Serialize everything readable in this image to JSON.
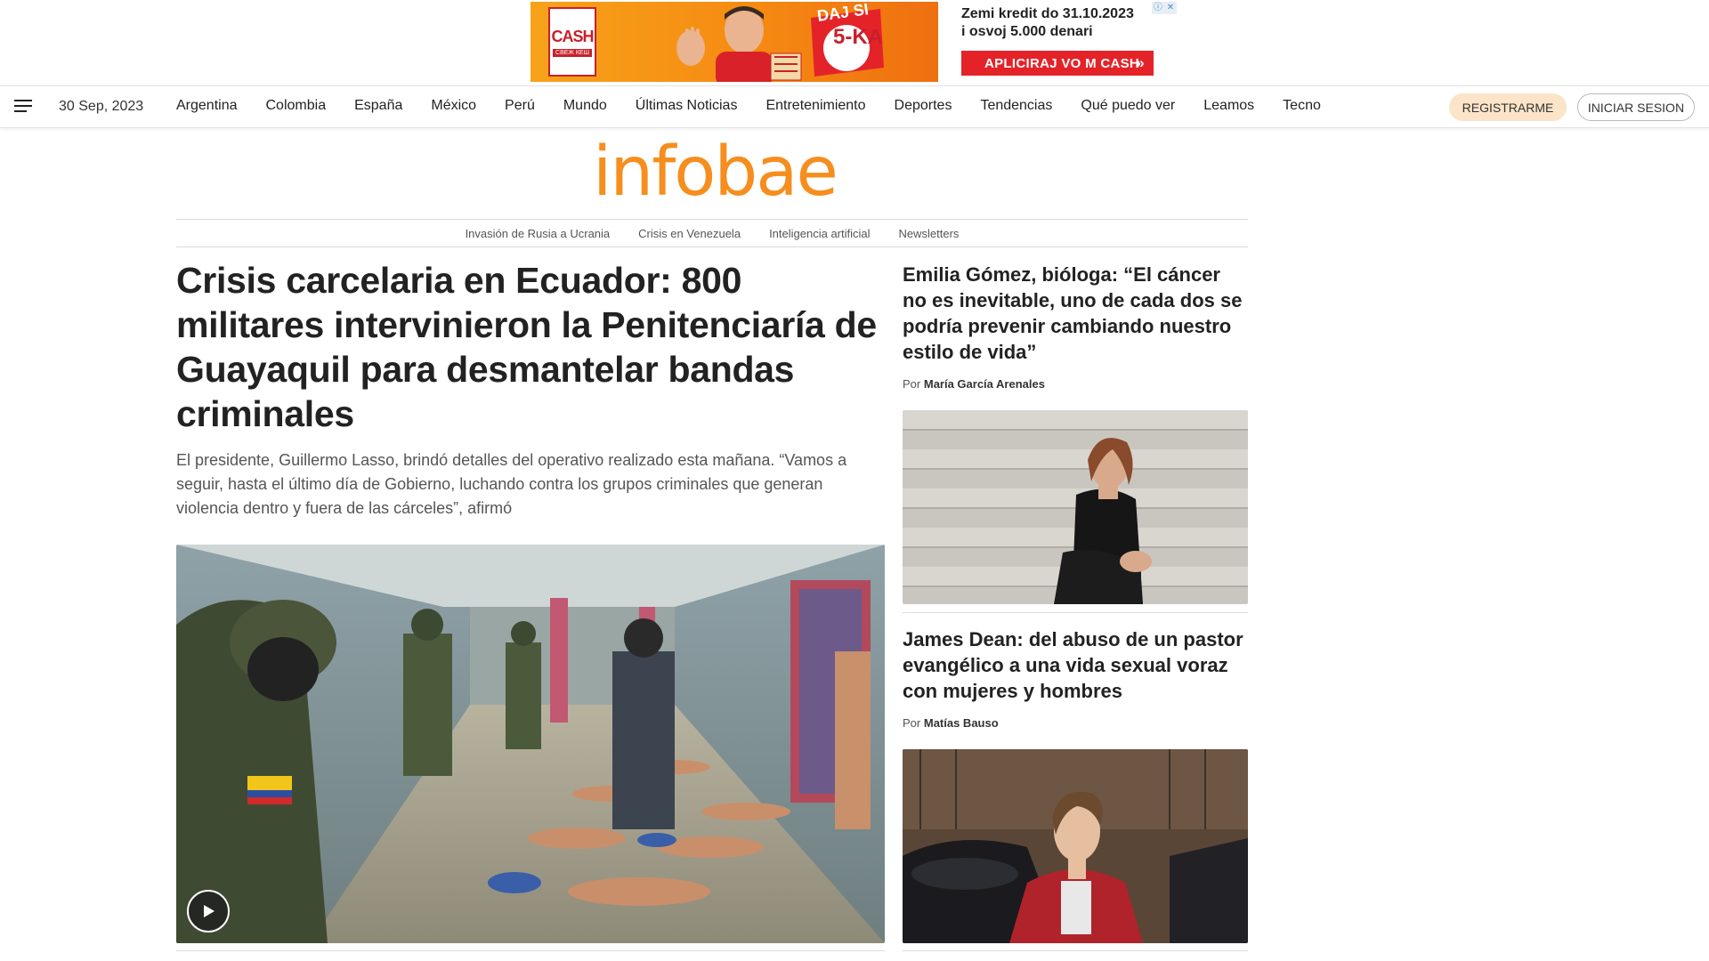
{
  "ad": {
    "brand": "CASH",
    "brand_sub": "СВЕЖ КЕШ",
    "promo_top": "DAJ SI",
    "promo_main": "5-KA",
    "line1": "Zemi kredit do 31.10.2023",
    "line2": "i osvoj 5.000 denari",
    "cta": "APLICIRAJ VO M CASH",
    "colors": {
      "orange": "#f58a12",
      "red": "#e42329"
    }
  },
  "topnav": {
    "date": "30 Sep, 2023",
    "links": [
      "Argentina",
      "Colombia",
      "España",
      "México",
      "Perú",
      "Mundo",
      "Últimas Noticias",
      "Entretenimiento",
      "Deportes",
      "Tendencias",
      "Qué puedo ver",
      "Leamos",
      "Tecno"
    ],
    "register": "REGISTRARME",
    "login": "INICIAR SESION"
  },
  "logo": {
    "text": "infobae",
    "color": "#f68e1f"
  },
  "subnav": [
    "Invasión de Rusia a Ucrania",
    "Crisis en Venezuela",
    "Inteligencia artificial",
    "Newsletters"
  ],
  "main_story": {
    "headline": "Crisis carcelaria en Ecuador: 800 militares intervinieron la Penitenciaría de Guayaquil para desmantelar bandas criminales",
    "deck": "El presidente, Guillermo Lasso, brindó detalles del operativo realizado esta mañana. “Vamos a seguir, hasta el último día de Gobierno, luchando contra los grupos criminales que generan violencia dentro y fuera de las cárceles”, afirmó",
    "image_icon": "play-icon"
  },
  "side_stories": [
    {
      "headline": "Emilia Gómez, bióloga: “El cáncer no es inevitable, uno de cada dos se podría prevenir cambiando nuestro estilo de vida”",
      "by": "Por",
      "author": "María García Arenales"
    },
    {
      "headline": "James Dean: del abuso de un pastor evangélico a una vida sexual voraz con mujeres y hombres",
      "by": "Por",
      "author": "Matías Bauso"
    }
  ]
}
